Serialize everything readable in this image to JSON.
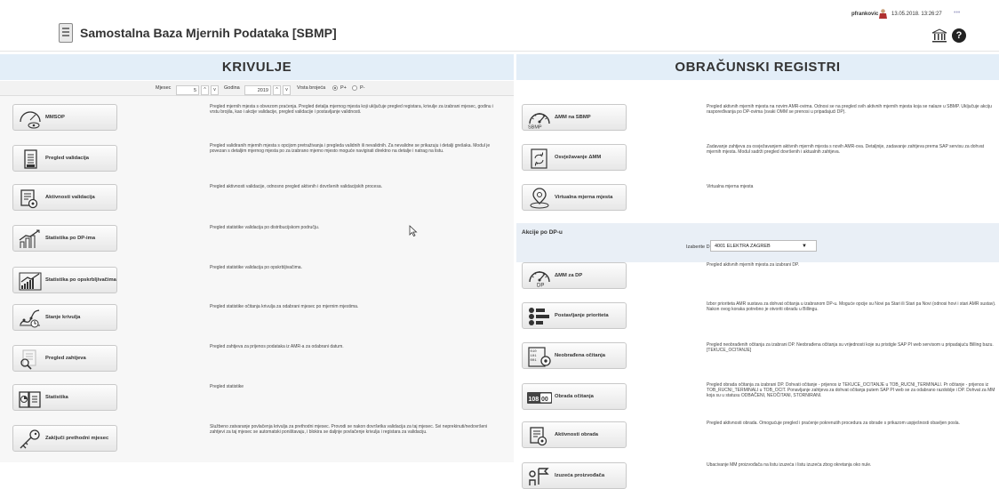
{
  "header": {
    "title": "Samostalna Baza Mjernih Podataka [SBMP]",
    "user": "pfrankovic",
    "datetime": "13.05.2018. 13:26:27",
    "more": "•••",
    "help": "?"
  },
  "left": {
    "heading": "KRIVULJE",
    "controls": {
      "month_label": "Mjesec",
      "month": "5",
      "year_label": "Godina",
      "year": "2019",
      "type_label": "Vrsta brojeća",
      "opt1": "P+",
      "opt2": "P-",
      "selected": "P+"
    },
    "items": [
      {
        "label": "MMSOP",
        "desc": "Pregled mjernih mjesta s obvezom praćenja. Pregled detalja mjernog mjesta koji uključuje pregled registara, krivulje za izabrani mjesec, godinu i vrstu brojila, kao i akcije validacije, pregled validacije i postavljanje validnosti."
      },
      {
        "label": "Pregled validacija",
        "desc": "Pregled validiranih mjernih mjesta s opcijom pretraživanja i pregleda validnih ili nevalidnih. Za nevalidne se prikazuju i detalji grešaka. Modul je povezan s detaljim mjernog mjesta po za izabrano mjerno mjesto moguće navigirati direktno na detalje i natrag na listu."
      },
      {
        "label": "Aktivnosti validacija",
        "desc": "Pregled aktivnosti validacije, odnosno pregled aktivnih i dovršenih validacijskih procesa."
      },
      {
        "label": "Statistika po DP-ima",
        "desc": "Pregled statistike validacija po distribucijskom području."
      },
      {
        "label": "Statistika po opskrbljivačima",
        "desc": "Pregled statistike validacija po opskrbljivačima."
      },
      {
        "label": "Stanje krivulja",
        "desc": "Pregled statistike očitanja krivulja za odabrani mjesec po mjernim mjestima."
      },
      {
        "label": "Pregled zahtjeva",
        "desc": "Pregled zahtjeva za prijenos podataka iz AMR-a za odabrani datum."
      },
      {
        "label": "Statistika",
        "desc": "Pregled statistike"
      },
      {
        "label": "Zaključi prethodni mjesec",
        "desc": "Službeno zatvaranje povlačenja krivulja za prethodni mjesec. Provodi se nakon dovršetka validacija za taj mjesec. Svi neprekinuti/nedovršeni zahtjevi za taj mjesec se automatski poništavaju, i blokira se daljnje povlačenje krivulja i registara za validaciju."
      }
    ]
  },
  "right": {
    "heading": "OBRAČUNSKI REGISTRI",
    "items_top": [
      {
        "label": "ΔMM na SBMP",
        "sub": "SBMP",
        "desc": "Pregled aktivnih mjernih mjesta na novim AMR-ovima. Odnosi se na pregled svih aktivnih mjernih mjesta koja se nalaze u SBMP. Uključuje akciju raspoređivanja po DP-ovima (svaki OMM se prenosi u pripadajući DP)."
      },
      {
        "label": "Osvježavanje ΔMM",
        "desc": "Zadavanje zahtjeva za osvježavanjem aktivnih mjernih mjesta s novih AMR-ova. Detaljnije, zadavanje zahtjeva prema SAP servisu za dohvat mjernih mjesta. Modul sadrži pregled dovršenih i aktualnih zahtjeva."
      },
      {
        "label": "Virtualna mjerna mjesta",
        "desc": "Virtualna mjerna mjesta"
      }
    ],
    "dp": {
      "title": "Akcije po DP-u",
      "select_label": "Izaberite DP:",
      "selected": "4001 ELEKTRA ZAGREB"
    },
    "items_bottom": [
      {
        "label": "ΔMM za DP",
        "sub": "DP",
        "desc": "Pregled aktivnih mjernih mjesta za izabrani DP."
      },
      {
        "label": "Postavljanje prioriteta",
        "desc": "Izbor prioriteta AMR sustava za dohvat očitanja u izabranom DP-u. Moguće opcije su Novi pa Stari ili Stari pa Novi (odnosi hovi i stari AMR sustav). Nakon ovog koraka potrebno je otvoriti obradu u Billingu."
      },
      {
        "label": "Neobrađena očitanja",
        "icon_text": "010 101 001",
        "desc": "Pregled neobrađenih očitanja za izabrani DP. Neobrađena očitanja su vrijednosti koje su pristigle SAP PI web servisom u pripadajuću Billing bazu. [TEKUCE_OCITANJE]"
      },
      {
        "label": "Obrada očitanja",
        "icon_text": "108",
        "icon_text2": "00",
        "desc": "Pregled obrada očitanja za izabrani DP. Dohvati očitanje - prijenos iz TEKUCE_OCITANJE u TOB_RUCNI_TERMINALI. Pr očitanje - prijenos iz TOB_RUCNI_TERMINALI u TOB_OCIT. Ponavljanje zahtjeva za dohvat očitanja putem SAP PI web se za odabrano razdoblje i DP. Dohvat za MM koja su u statusu ODBAČENI, NEOČITANI, STORNIRANI."
      },
      {
        "label": "Aktivnosti obrada",
        "desc": "Pregled aktivnosti obrada. Omogućuje pregled i praćenje pokrenutih procedura za obrade s prikazom uspješnosti obavljen posla."
      },
      {
        "label": "Izuzeća proizvođača",
        "desc": "Ubacivanje MM proizvođača na listu izuzeća i listu izuzeća zbog okretanja oko nule."
      }
    ]
  }
}
